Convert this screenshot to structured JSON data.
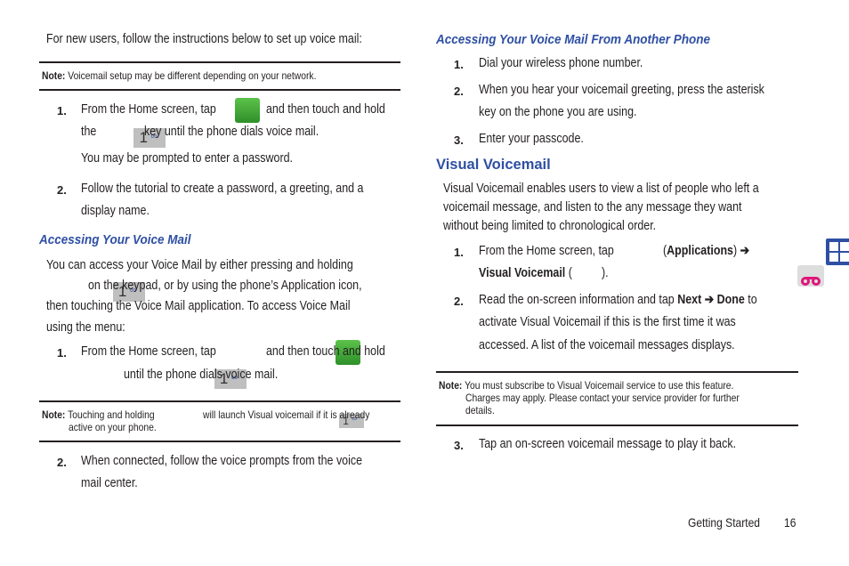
{
  "left": {
    "intro": "For new users, follow the instructions below to set up voice mail:",
    "note1": {
      "label": "Note:",
      "text": "Voicemail setup may be different depending on your network."
    },
    "setup_steps": [
      {
        "num": "1.",
        "before": "From the Home screen, tap",
        "after": "and then touch and hold",
        "line2_before": "the",
        "line2_after": "key until the phone dials voice mail.",
        "sub": "You may be prompted to enter a password."
      },
      {
        "num": "2.",
        "line1": "Follow the tutorial to create a password, a greeting, and a",
        "line2": "display name."
      }
    ],
    "heading": "Accessing Your Voice Mail",
    "para": {
      "line1": "You can access your Voice Mail by either pressing and holding",
      "line2": "on the keypad, or by using the phone’s Application icon,",
      "line3": "then touching the Voice Mail application. To access Voice Mail",
      "line4": "using the menu:"
    },
    "access_steps": [
      {
        "num": "1.",
        "before": "From the Home screen, tap",
        "after": "and then touch and hold",
        "line2_after": "until the phone dials voice mail."
      },
      {
        "num": "2.",
        "line1": "When connected, follow the voice prompts from the voice",
        "line2": "mail center."
      }
    ],
    "note2": {
      "label": "Note:",
      "before": "Touching and holding",
      "after": "will launch Visual voicemail if it is already",
      "line2": "active on your phone."
    }
  },
  "right": {
    "heading": "Accessing Your Voice Mail From Another Phone",
    "steps": [
      {
        "num": "1.",
        "line1": "Dial your wireless phone number."
      },
      {
        "num": "2.",
        "line1": "When you hear your voicemail greeting, press the asterisk",
        "line2": "key on the phone you are using."
      },
      {
        "num": "3.",
        "line1": "Enter your passcode."
      }
    ],
    "vv_heading": "Visual Voicemail",
    "vv_para": {
      "line1": "Visual Voicemail enables users to view a list of people who left a",
      "line2": "voicemail message, and listen to the any message they want",
      "line3": "without being limited to chronological order."
    },
    "vv_steps": [
      {
        "num": "1.",
        "before": "From the Home screen, tap",
        "apps": "Applications",
        "arrow": "➔",
        "line2_bold": "Visual Voicemail"
      },
      {
        "num": "2.",
        "before": "Read the on-screen information and tap",
        "bold1": "Next",
        "arrow": "➔",
        "bold2": "Done",
        "after": "to",
        "line2": "activate Visual Voicemail if this is the first time it was",
        "line3": "accessed. A list of the voicemail messages displays."
      },
      {
        "num": "3.",
        "line1": "Tap an on-screen voicemail message to play it back."
      }
    ],
    "note": {
      "label": "Note:",
      "line1": "You must subscribe to Visual Voicemail service to use this feature.",
      "line2": "Charges may apply. Please contact your service provider for further",
      "line3": "details."
    }
  },
  "key_label": "1",
  "key_glyph": "∞",
  "footer": {
    "section": "Getting Started",
    "page": "16"
  }
}
